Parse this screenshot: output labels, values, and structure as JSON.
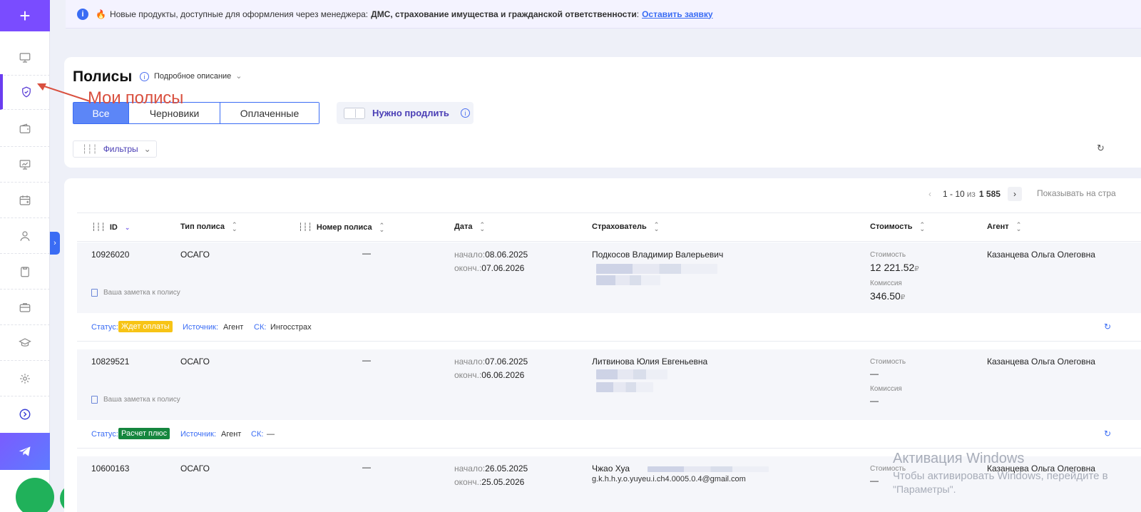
{
  "sidebar": {
    "add_label": "+",
    "items": [
      {
        "icon": "monitor-icon"
      },
      {
        "icon": "shield-check-icon",
        "active": true
      },
      {
        "icon": "wallet-icon"
      },
      {
        "icon": "presentation-icon"
      },
      {
        "icon": "calendar-add-icon"
      },
      {
        "icon": "user-icon"
      },
      {
        "icon": "clipboard-icon"
      },
      {
        "icon": "briefcase-icon"
      },
      {
        "icon": "graduation-cap-icon"
      },
      {
        "icon": "gear-icon"
      },
      {
        "icon": "chevron-right-circle-icon"
      }
    ],
    "telegram_icon": "telegram-icon",
    "expand_label": "›"
  },
  "notice": {
    "fire": "🔥",
    "text": "Новые продукты, доступные для оформления через менеджера:",
    "bold": "ДМС, страхование имущества и гражданской ответственности",
    "colon": ":",
    "link": "Оставить заявку"
  },
  "header": {
    "title": "Полисы",
    "desc_toggle": "Подробное описание",
    "tabs": [
      {
        "label": "Все",
        "active": true
      },
      {
        "label": "Черновики",
        "active": false
      },
      {
        "label": "Оплаченные",
        "active": false
      }
    ],
    "renew_label": "Нужно продлить",
    "filters_label": "Фильтры"
  },
  "annotation": {
    "text": "Мои полисы",
    "color": "#d9503f"
  },
  "pager": {
    "prev": "‹",
    "range": "1 - 10",
    "of": "из",
    "total": "1 585",
    "next": "›",
    "show_per_page": "Показывать на стра"
  },
  "table": {
    "columns": [
      "ID",
      "Тип полиса",
      "Номер полиса",
      "Дата",
      "Страхователь",
      "Стоимость",
      "Агент"
    ],
    "rows": [
      {
        "id": "10926020",
        "type": "ОСАГО",
        "number": "—",
        "start_label": "начало:",
        "start": "08.06.2025",
        "end_label": "оконч.:",
        "end": "07.06.2026",
        "insurer": "Подкосов Владимир Валерьевич",
        "note": "Ваша заметка к полису",
        "cost_label": "Стоимость",
        "cost": "12 221.52",
        "commission_label": "Комиссия",
        "commission": "346.50",
        "currency": "₽",
        "agent": "Казанцева Ольга Олеговна",
        "status_label": "Статус:",
        "status": "Ждет оплаты",
        "source_label": "Источник:",
        "source": "Агент",
        "sk_label": "СК:",
        "sk": "Ингосстрах"
      },
      {
        "id": "10829521",
        "type": "ОСАГО",
        "number": "—",
        "start_label": "начало:",
        "start": "07.06.2025",
        "end_label": "оконч.:",
        "end": "06.06.2026",
        "insurer": "Литвинова Юлия Евгеньевна",
        "note": "Ваша заметка к полису",
        "cost_label": "Стоимость",
        "cost": "—",
        "commission_label": "Комиссия",
        "commission": "—",
        "agent": "Казанцева Ольга Олеговна",
        "status_label": "Статус:",
        "status": "Расчет плюс",
        "source_label": "Источник:",
        "source": "Агент",
        "sk_label": "СК:",
        "sk": "—"
      },
      {
        "id": "10600163",
        "type": "ОСАГО",
        "number": "—",
        "start_label": "начало:",
        "start": "26.05.2025",
        "end_label": "оконч.:",
        "end": "25.05.2026",
        "insurer": "Чжао Хуа",
        "email": "g.k.h.h.y.o.yuyeu.i.ch4.0005.0.4@gmail.com",
        "cost_label": "Стоимость",
        "cost": "—",
        "agent": "Казанцева Ольга Олеговна"
      }
    ]
  },
  "watermark": {
    "line1": "Активация Windows",
    "line2": "Чтобы активировать Windows, перейдите в",
    "line3": "\"Параметры\"."
  },
  "colors": {
    "accent": "#3a6cf4",
    "brand": "#7a4cff",
    "status_wait": "#f7c416",
    "status_calc": "#15863e"
  }
}
